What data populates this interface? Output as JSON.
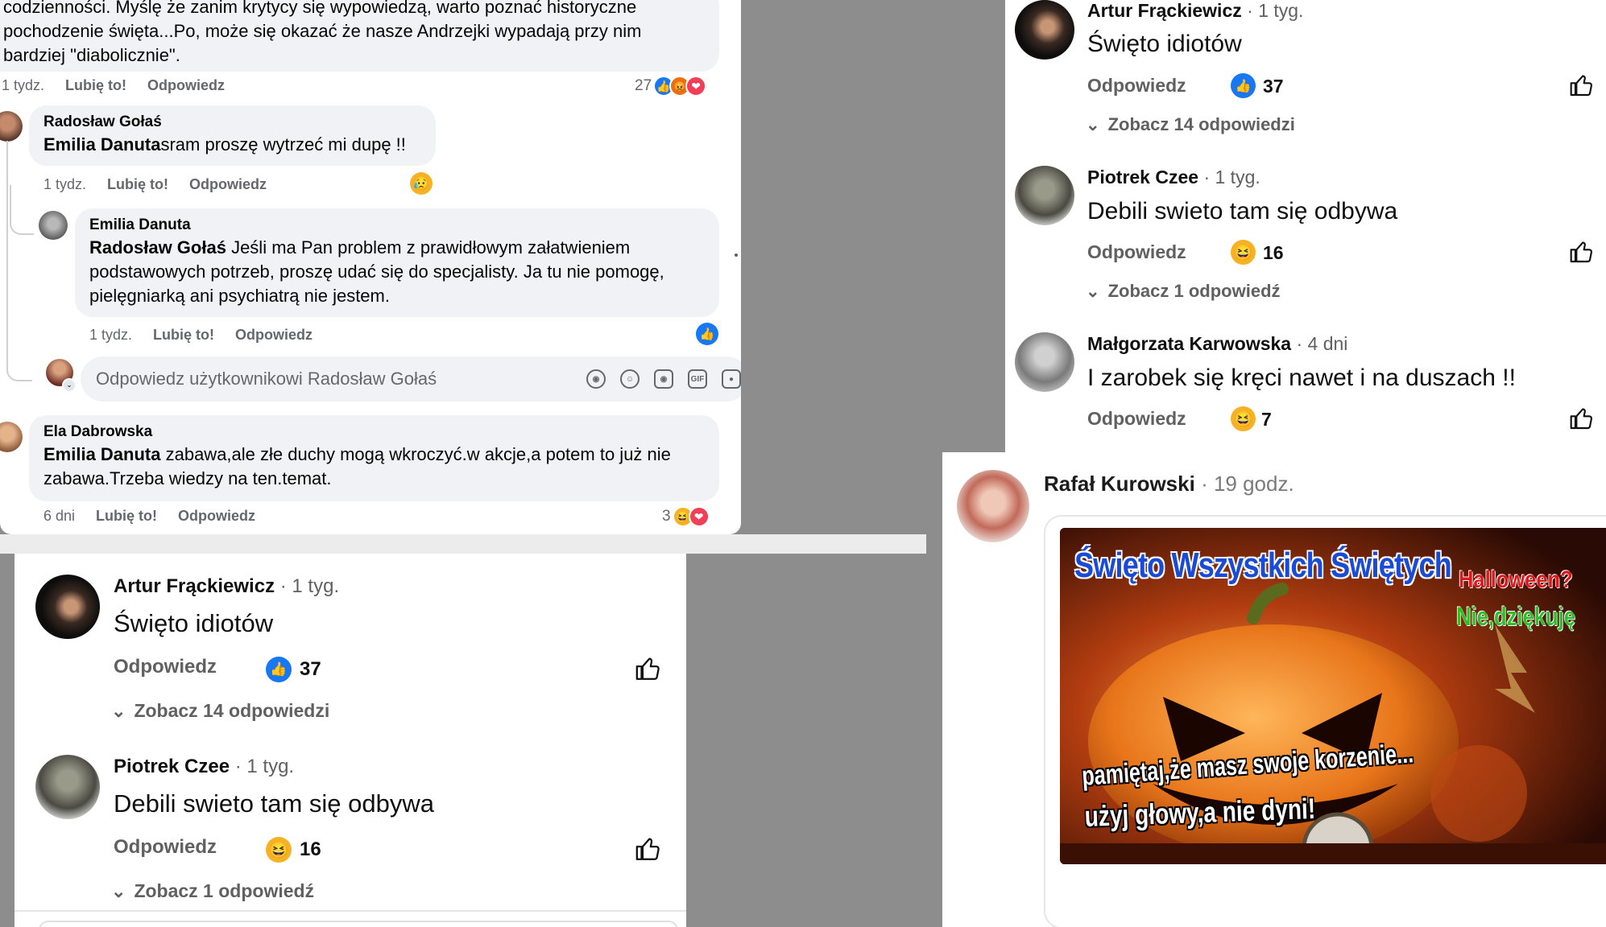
{
  "fb_panel": {
    "top_comment": {
      "text_line1": "codzienności. Myślę że zanim krytycy się wypowiedzą, warto poznać historyczne",
      "text_line2": "pochodzenie święta...Po, może się okazać że nasze Andrzejki wypadają przy nim",
      "text_line3": "bardziej \"diabolicznie\".",
      "time": "1 tydz.",
      "like": "Lubię to!",
      "reply": "Odpowiedz",
      "reaction_count": "27"
    },
    "comments": [
      {
        "name": "Radosław Gołaś",
        "mention": "Emilia Danuta",
        "text": "sram proszę wytrzeć mi dupę !!",
        "time": "1 tydz.",
        "like": "Lubię to!",
        "reply": "Odpowiedz"
      },
      {
        "name": "Emilia Danuta",
        "mention": "Radosław Gołaś",
        "text_line1": " Jeśli ma Pan problem z prawidłowym załatwieniem",
        "text_line2": "podstawowych potrzeb, proszę udać się do specjalisty. Ja tu nie pomogę,",
        "text_line3": "pielęgniarką ani psychiatrą nie jestem.",
        "time": "1 tydz.",
        "like": "Lubię to!",
        "reply": "Odpowiedz"
      },
      {
        "name": "Ela Dabrowska",
        "mention": "Emilia Danuta",
        "text_line1": " zabawa,ale złe duchy mogą wkroczyć.w akcje,a potem to już nie",
        "text_line2": "zabawa.Trzeba wiedzy na ten.temat.",
        "time": "6 dni",
        "like": "Lubię to!",
        "reply": "Odpowiedz",
        "reaction_count": "3"
      }
    ],
    "reply_placeholder": "Odpowiedz użytkownikowi Radosław Gołaś",
    "reply_icons": [
      "avatar-icon",
      "emoji-icon",
      "camera-icon",
      "gif-icon",
      "sticker-icon"
    ]
  },
  "yt_left": {
    "comments": [
      {
        "name": "Artur Frąckiewicz",
        "time": "· 1 tyg.",
        "text": "Święto idiotów",
        "reply": "Odpowiedz",
        "count": "37",
        "reaction": "like-icon",
        "more": "Zobacz 14 odpowiedzi"
      },
      {
        "name": "Piotrek Czee",
        "time": "· 1 tyg.",
        "text": "Debili swieto tam się odbywa",
        "reply": "Odpowiedz",
        "count": "16",
        "reaction": "laugh-icon",
        "more": "Zobacz 1 odpowiedź"
      }
    ]
  },
  "yt_right": {
    "comments": [
      {
        "name": "Artur Frąckiewicz",
        "time": "· 1 tyg.",
        "text": "Święto idiotów",
        "reply": "Odpowiedz",
        "count": "37",
        "reaction": "like-icon",
        "more": "Zobacz 14 odpowiedzi"
      },
      {
        "name": "Piotrek Czee",
        "time": "· 1 tyg.",
        "text": "Debili swieto tam się odbywa",
        "reply": "Odpowiedz",
        "count": "16",
        "reaction": "laugh-icon",
        "more": "Zobacz 1 odpowiedź"
      },
      {
        "name": "Małgorzata Karwowska",
        "time": "· 4 dni",
        "text": "I zarobek się kręci nawet i na duszach !!",
        "reply": "Odpowiedz",
        "count": "7",
        "reaction": "laugh-icon"
      }
    ]
  },
  "post_panel": {
    "name": "Rafał Kurowski",
    "time": "· 19 godz.",
    "banner": {
      "title": "Święto Wszystkich Świętych",
      "side_line1": "Halloween?",
      "side_line2": "Nie,dziękuję",
      "bottom_line1": "pamiętaj,że masz swoje korzenie...",
      "bottom_line2": "użyj głowy,a nie dyni!"
    }
  },
  "colors": {
    "fb_blue": "#1877f2",
    "bubble": "#f0f2f5",
    "yt_text": "#0f0f0f",
    "yt_secondary": "#606060",
    "backdrop": "#8d8d8d",
    "pumpkin": "#e8751a"
  }
}
